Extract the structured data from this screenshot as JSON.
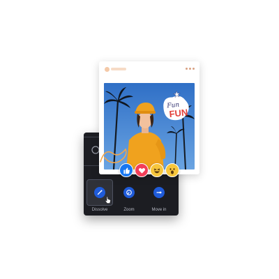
{
  "animation_panel": {
    "options": [
      {
        "label": "Dissolve",
        "icon": "wand-icon"
      },
      {
        "label": "Zoom",
        "icon": "zoom-dial-icon"
      },
      {
        "label": "Move in",
        "icon": "arrow-right-icon"
      }
    ],
    "partial_top_label": "No",
    "selected_option": "Dissolve"
  },
  "post": {
    "sticker_text": "FUN",
    "sticker_script": "Fun"
  },
  "reactions": [
    "like-icon",
    "love-icon",
    "haha-icon",
    "wow-icon"
  ],
  "colors": {
    "panel_bg": "#1c1d22",
    "accent_blue": "#1f5bd9",
    "like_blue": "#1877f2",
    "love_red": "#f33e58",
    "emoji_yellow": "#f7c63c",
    "sweater_orange": "#f0a21e",
    "sky_blue": "#3a7fd1"
  }
}
